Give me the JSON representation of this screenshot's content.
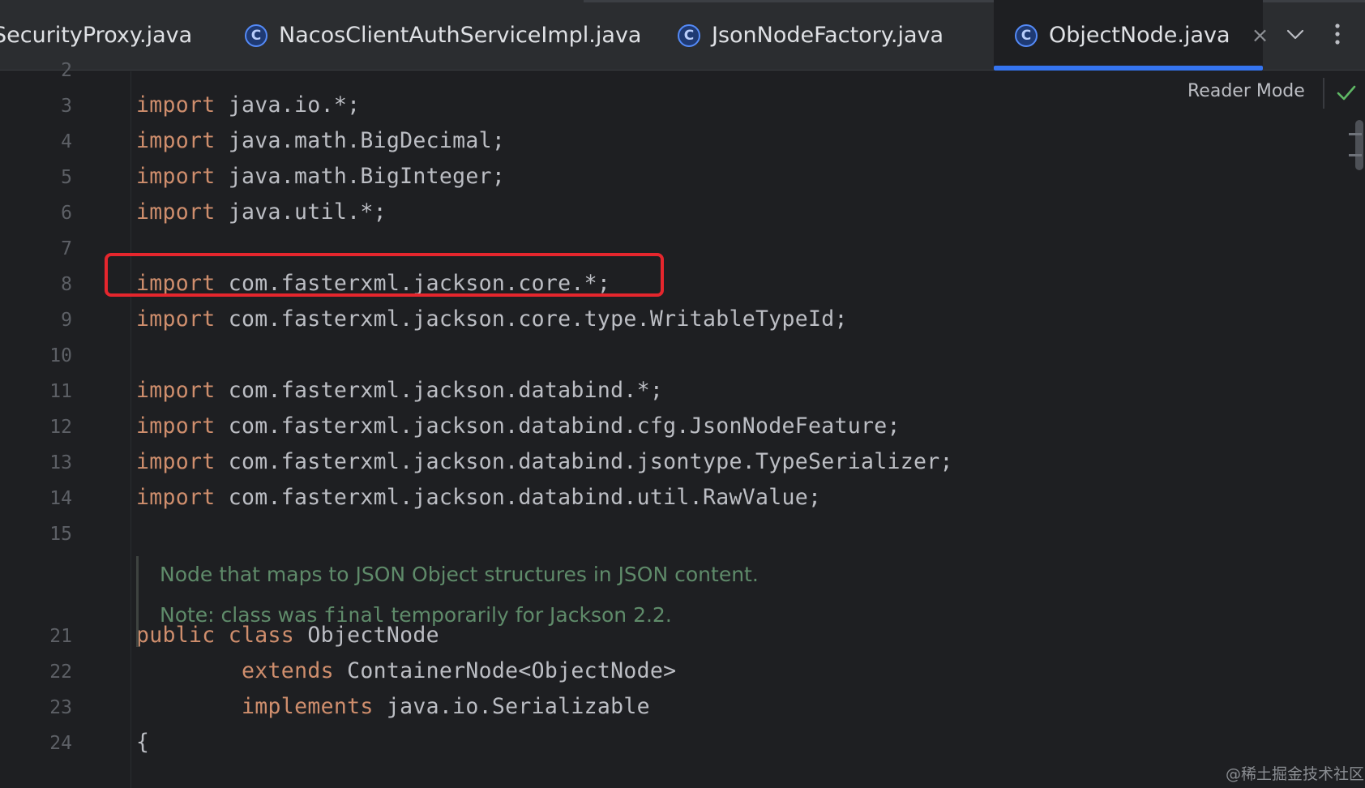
{
  "tabs": [
    {
      "label": "SecurityProxy.java",
      "active": false,
      "icon": "class-icon"
    },
    {
      "label": "NacosClientAuthServiceImpl.java",
      "active": false,
      "icon": "class-icon"
    },
    {
      "label": "JsonNodeFactory.java",
      "active": false,
      "icon": "class-icon"
    },
    {
      "label": "ObjectNode.java",
      "active": true,
      "icon": "class-icon",
      "close": "×"
    }
  ],
  "class_icon_glyph": "C",
  "tab_actions": {
    "more_tabs_icon": "chevron-down-icon",
    "options_icon": "kebab-menu-icon"
  },
  "editor": {
    "reader_mode_label": "Reader Mode",
    "status_icon": "check-icon",
    "lines": [
      {
        "no": "2",
        "kw": "",
        "text": ""
      },
      {
        "no": "3",
        "kw": "import",
        "text": " java.io.*;"
      },
      {
        "no": "4",
        "kw": "import",
        "text": " java.math.BigDecimal;"
      },
      {
        "no": "5",
        "kw": "import",
        "text": " java.math.BigInteger;"
      },
      {
        "no": "6",
        "kw": "import",
        "text": " java.util.*;"
      },
      {
        "no": "7",
        "kw": "",
        "text": ""
      },
      {
        "no": "8",
        "kw": "import",
        "text": " com.fasterxml.jackson.core.*;"
      },
      {
        "no": "9",
        "kw": "import",
        "text": " com.fasterxml.jackson.core.type.WritableTypeId;"
      },
      {
        "no": "10",
        "kw": "",
        "text": ""
      },
      {
        "no": "11",
        "kw": "import",
        "text": " com.fasterxml.jackson.databind.*;"
      },
      {
        "no": "12",
        "kw": "import",
        "text": " com.fasterxml.jackson.databind.cfg.JsonNodeFeature;"
      },
      {
        "no": "13",
        "kw": "import",
        "text": " com.fasterxml.jackson.databind.jsontype.TypeSerializer;"
      },
      {
        "no": "14",
        "kw": "import",
        "text": " com.fasterxml.jackson.databind.util.RawValue;"
      },
      {
        "no": "15",
        "kw": "",
        "text": ""
      }
    ],
    "doc_comment": {
      "line1": "Node that maps to JSON Object structures in JSON content.",
      "line2_prefix": "Note: class was ",
      "line2_code": "final",
      "line2_suffix": " temporarily for Jackson 2.2."
    },
    "class_lines": [
      {
        "no": "21",
        "parts": [
          {
            "kw": "public class"
          },
          {
            "t": " ObjectNode"
          }
        ]
      },
      {
        "no": "22",
        "parts": [
          {
            "t": "        "
          },
          {
            "kw": "extends"
          },
          {
            "t": " ContainerNode<ObjectNode>"
          }
        ]
      },
      {
        "no": "23",
        "parts": [
          {
            "t": "        "
          },
          {
            "kw": "implements"
          },
          {
            "t": " java.io.Serializable"
          }
        ]
      },
      {
        "no": "24",
        "parts": [
          {
            "t": "{"
          }
        ]
      }
    ]
  },
  "colors": {
    "keyword": "#cf8e6d",
    "identifier": "#bcbec4",
    "doc_comment": "#5f8b6a",
    "highlight_box": "#e5262d",
    "active_tab_underline": "#3574f0"
  },
  "watermark": "@稀土掘金技术社区"
}
